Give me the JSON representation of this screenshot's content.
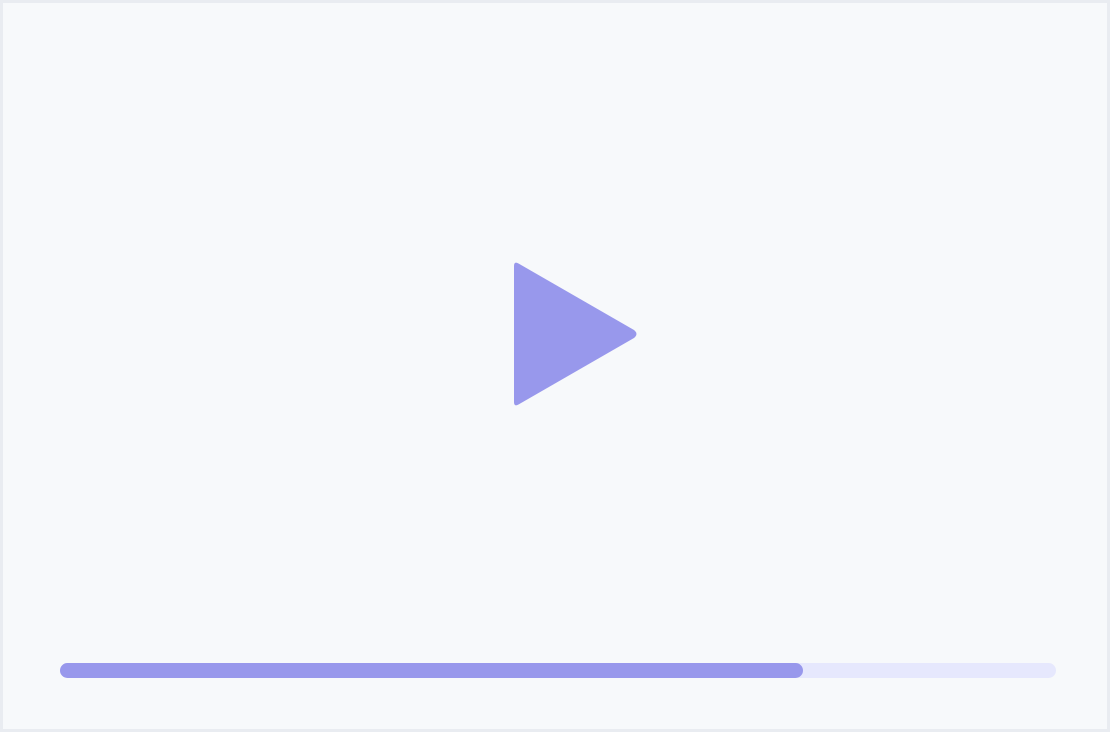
{
  "player": {
    "play_button": {
      "icon": "play-icon",
      "state": "paused"
    },
    "progress": {
      "fraction": 0.746
    },
    "colors": {
      "accent": "#9898ec",
      "track": "#e6e8fd",
      "background": "#f7f9fb",
      "border": "#e9ecf1"
    }
  }
}
